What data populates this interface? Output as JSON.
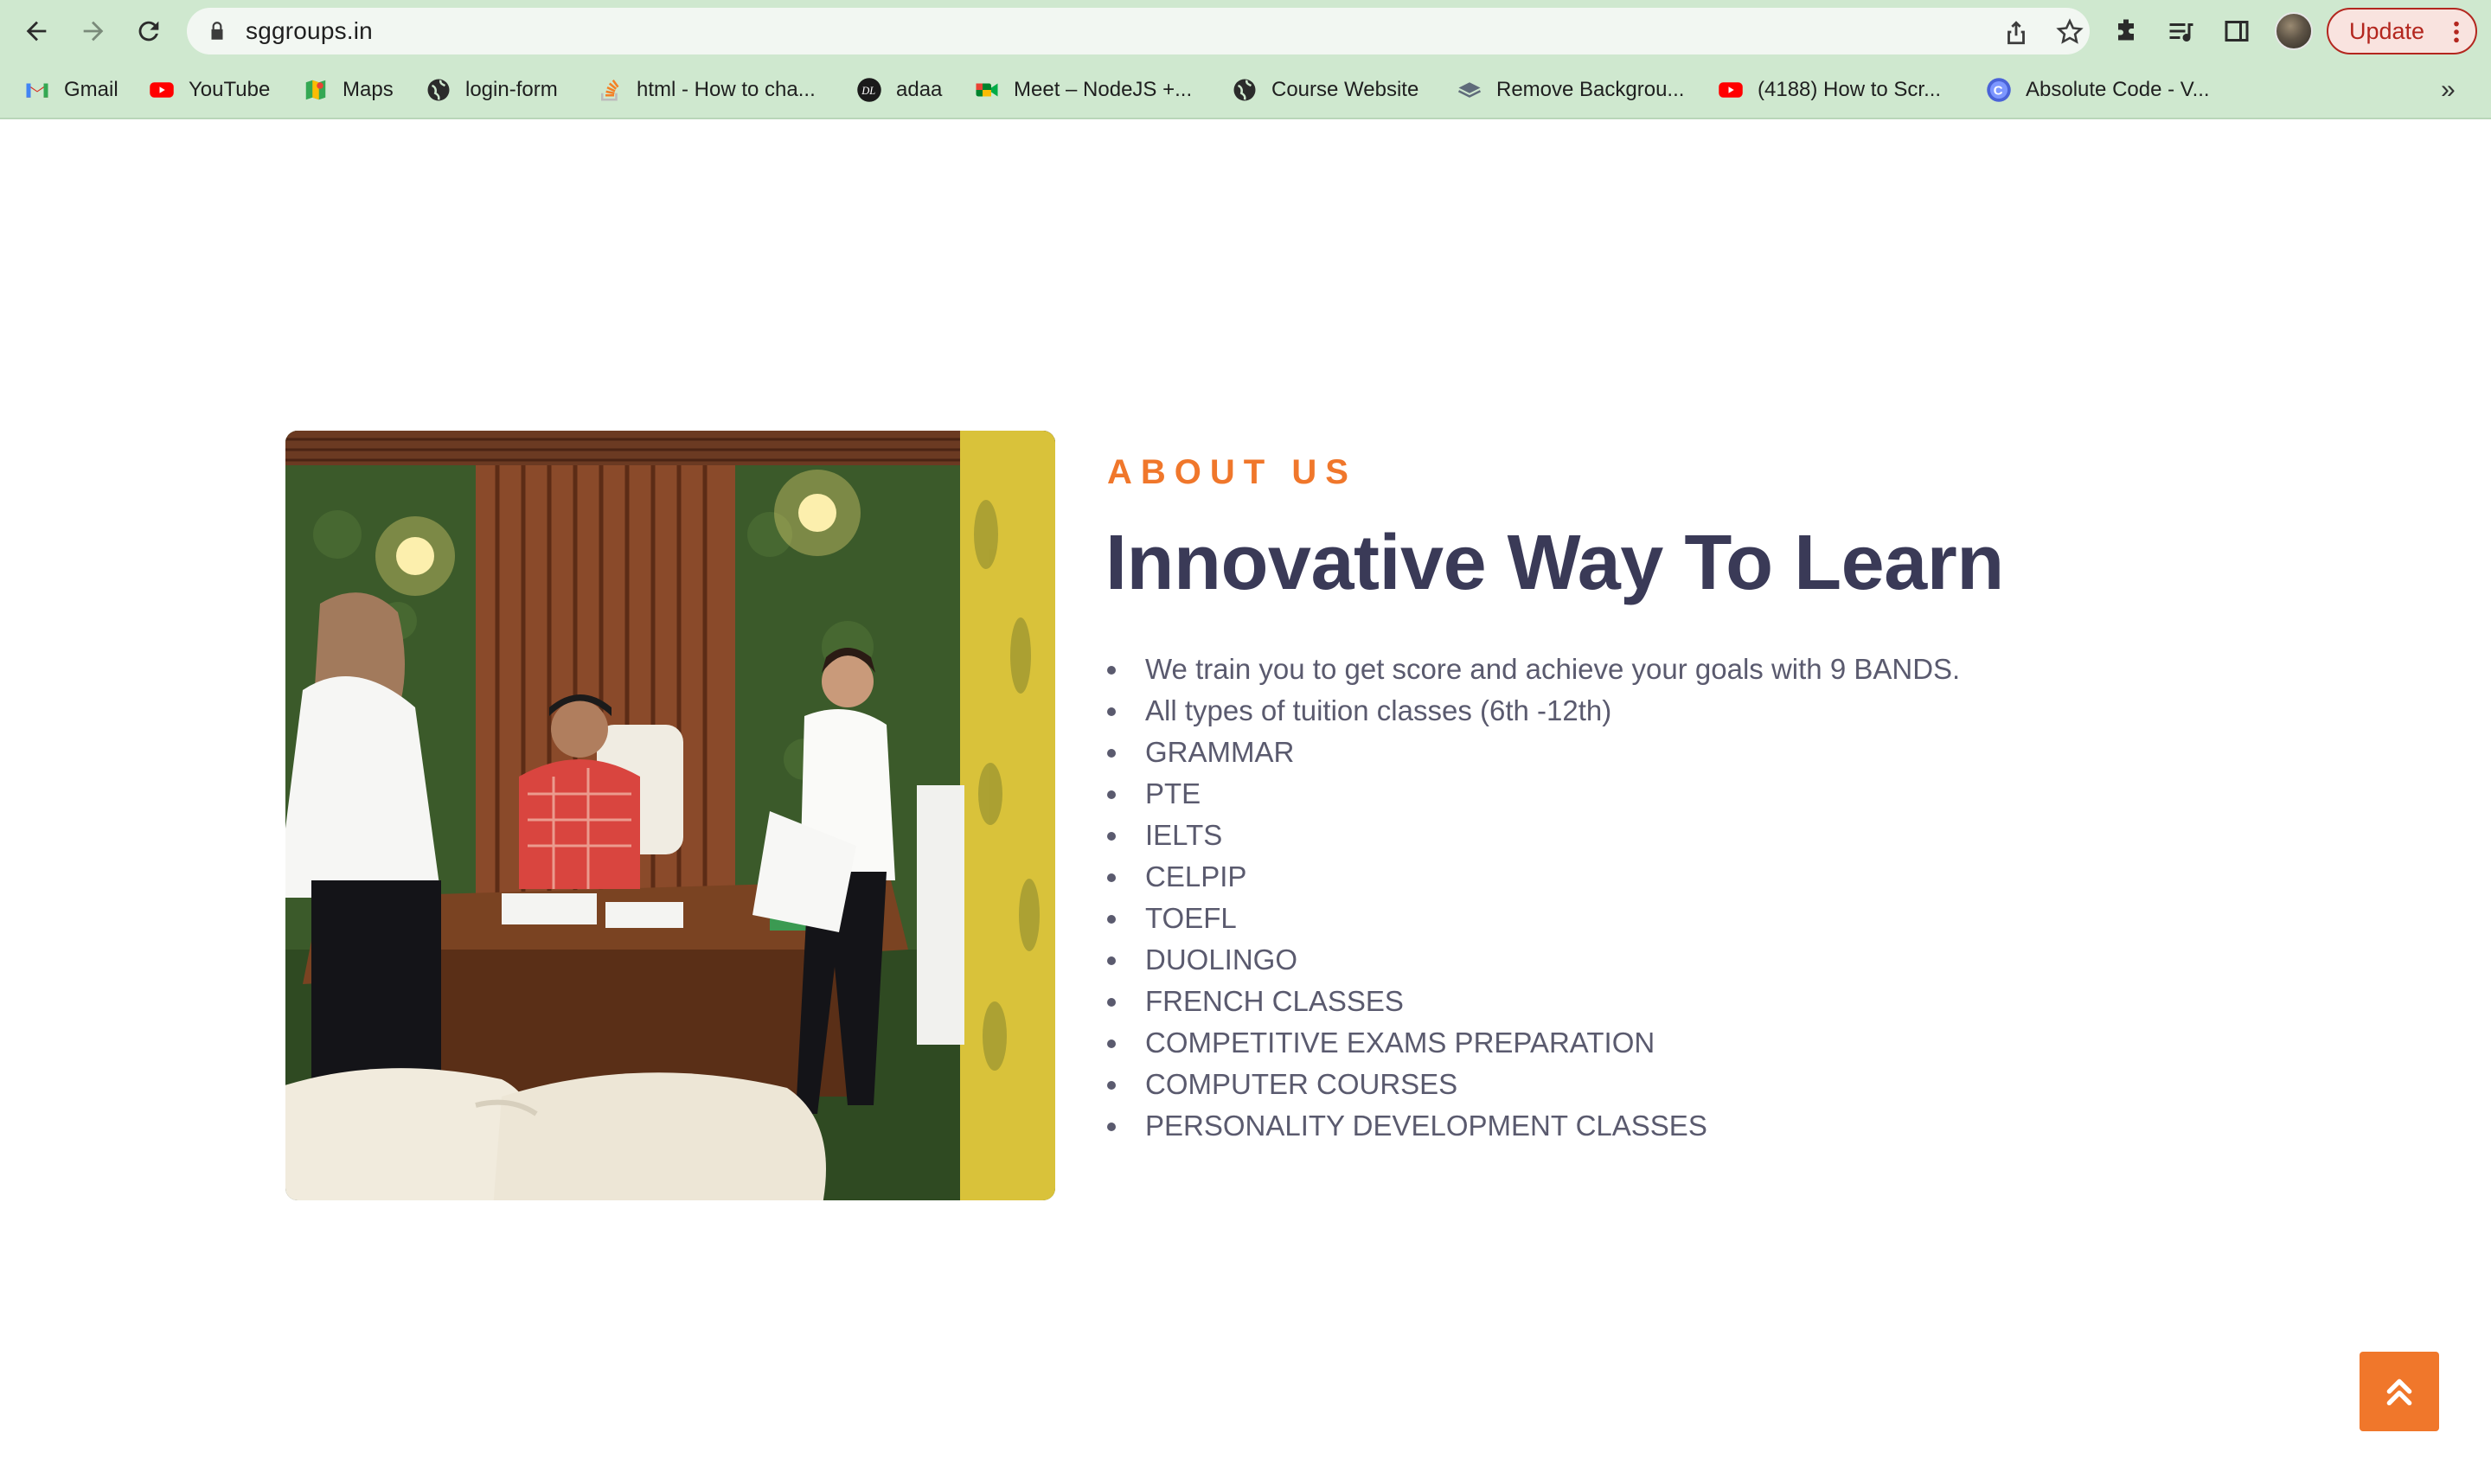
{
  "browser": {
    "url": "sggroups.in",
    "update_label": "Update",
    "bookmarks": [
      {
        "label": "Gmail",
        "icon": "gmail-icon"
      },
      {
        "label": "YouTube",
        "icon": "youtube-icon"
      },
      {
        "label": "Maps",
        "icon": "maps-icon"
      },
      {
        "label": "login-form",
        "icon": "globe-icon"
      },
      {
        "label": "html - How to cha...",
        "icon": "stackoverflow-icon"
      },
      {
        "label": "adaa",
        "icon": "dl-icon"
      },
      {
        "label": "Meet – NodeJS +...",
        "icon": "meet-icon"
      },
      {
        "label": "Course Website",
        "icon": "globe-icon"
      },
      {
        "label": "Remove Backgrou...",
        "icon": "layers-icon"
      },
      {
        "label": "(4188) How to Scr...",
        "icon": "youtube-icon"
      },
      {
        "label": "Absolute Code - V...",
        "icon": "absolute-code-icon"
      }
    ],
    "more_label": "»"
  },
  "about": {
    "eyebrow": "ABOUT US",
    "title": "Innovative Way To Learn",
    "features": [
      "We train you to get score and achieve your goals with 9 BANDS.",
      "All types of tuition classes (6th -12th)",
      "GRAMMAR",
      "PTE",
      "IELTS",
      "CELPIP",
      "TOEFL",
      "DUOLINGO",
      "FRENCH CLASSES",
      "COMPETITIVE EXAMS PREPARATION",
      "COMPUTER COURSES",
      "PERSONALITY DEVELOPMENT CLASSES"
    ]
  },
  "colors": {
    "accent": "#f0772b",
    "heading": "#3a3a57",
    "body_text": "#5a5a6e",
    "chrome_bg": "#cfe8cf"
  }
}
